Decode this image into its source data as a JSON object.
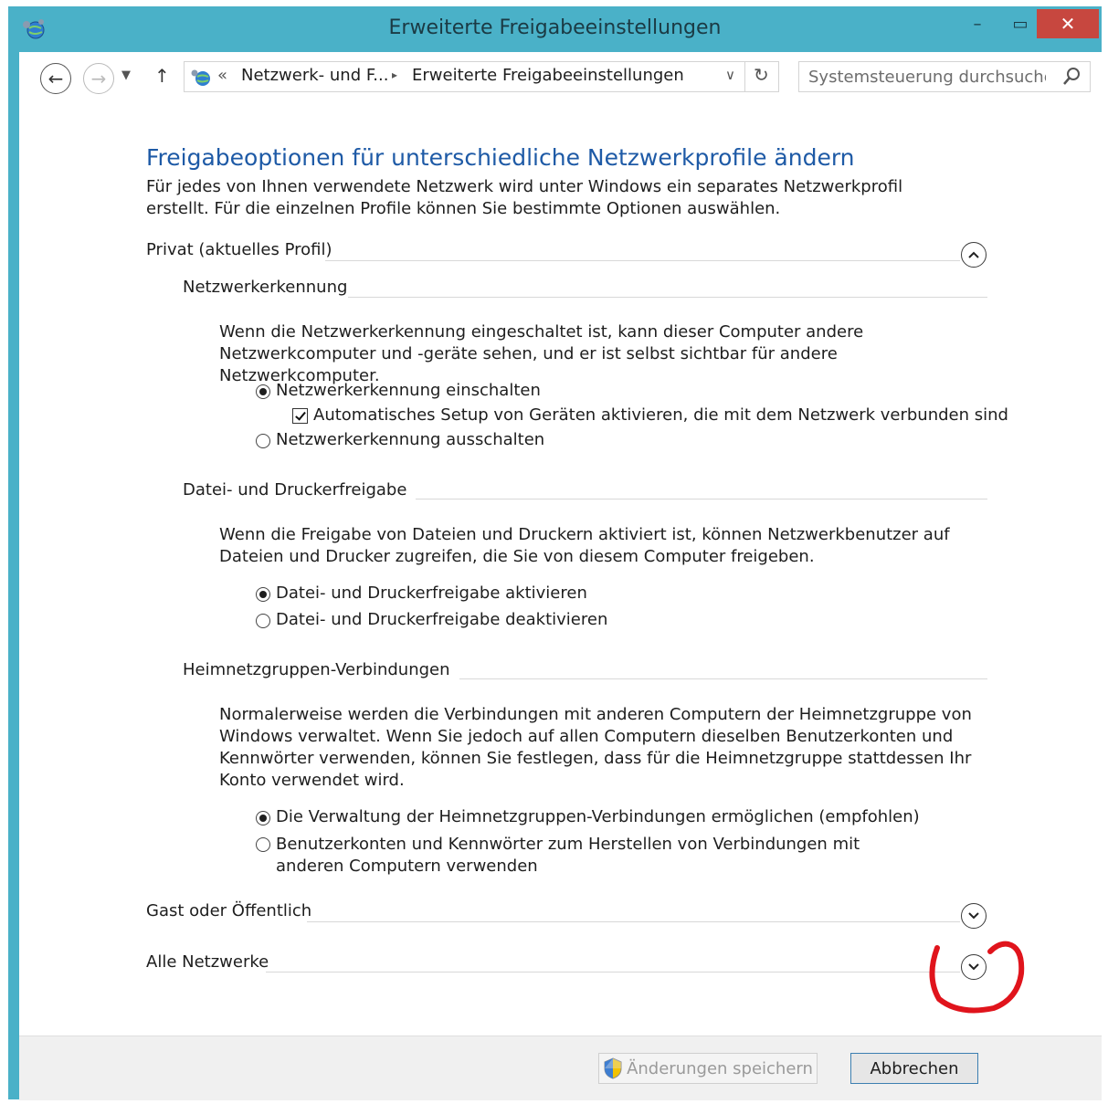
{
  "window": {
    "title": "Erweiterte Freigabeeinstellungen",
    "minimize": "–",
    "maximize": "▭",
    "close": "✕"
  },
  "nav": {
    "address": {
      "chevrons": "«",
      "crumbs": [
        "Netzwerk- und F...",
        "Erweiterte Freigabeeinstellungen"
      ],
      "separator": "▸"
    },
    "search_placeholder": "Systemsteuerung durchsuchen"
  },
  "page": {
    "heading": "Freigabeoptionen für unterschiedliche Netzwerkprofile ändern",
    "intro": "Für jedes von Ihnen verwendete Netzwerk wird unter Windows ein separates Netzwerkprofil erstellt. Für die einzelnen Profile können Sie bestimmte Optionen auswählen."
  },
  "profiles": {
    "private": {
      "label": "Privat (aktuelles Profil)",
      "expanded": true,
      "discovery": {
        "title": "Netzwerkerkennung",
        "description": "Wenn die Netzwerkerkennung eingeschaltet ist, kann dieser Computer andere Netzwerkcomputer und -geräte sehen, und er ist selbst sichtbar für andere Netzwerkcomputer.",
        "option_on": "Netzwerkerkennung einschalten",
        "auto_setup": "Automatisches Setup von Geräten aktivieren, die mit dem Netzwerk verbunden sind",
        "option_off": "Netzwerkerkennung ausschalten",
        "selected": "on",
        "auto_setup_checked": true
      },
      "file_sharing": {
        "title": "Datei- und Druckerfreigabe",
        "description": "Wenn die Freigabe von Dateien und Druckern aktiviert ist, können Netzwerkbenutzer auf Dateien und Drucker zugreifen, die Sie von diesem Computer freigeben.",
        "option_on": "Datei- und Druckerfreigabe aktivieren",
        "option_off": "Datei- und Druckerfreigabe deaktivieren",
        "selected": "on"
      },
      "homegroup": {
        "title": "Heimnetzgruppen-Verbindungen",
        "description": "Normalerweise werden die Verbindungen mit anderen Computern der Heimnetzgruppe von Windows verwaltet. Wenn Sie jedoch auf allen Computern dieselben Benutzerkonten und Kennwörter verwenden, können Sie festlegen, dass für die Heimnetzgruppe stattdessen Ihr Konto verwendet wird.",
        "option_windows": "Die Verwaltung der Heimnetzgruppen-Verbindungen ermöglichen (empfohlen)",
        "option_accounts": "Benutzerkonten und Kennwörter zum Herstellen von Verbindungen mit anderen Computern verwenden",
        "selected": "windows"
      }
    },
    "guest": {
      "label": "Gast oder Öffentlich",
      "expanded": false
    },
    "all": {
      "label": "Alle Netzwerke",
      "expanded": false
    }
  },
  "footer": {
    "save": "Änderungen speichern",
    "cancel": "Abbrechen"
  },
  "colors": {
    "window_frame": "#4ab1c8",
    "heading": "#1e5aa6",
    "close_button": "#c7473f",
    "annotation": "#e0141c"
  }
}
